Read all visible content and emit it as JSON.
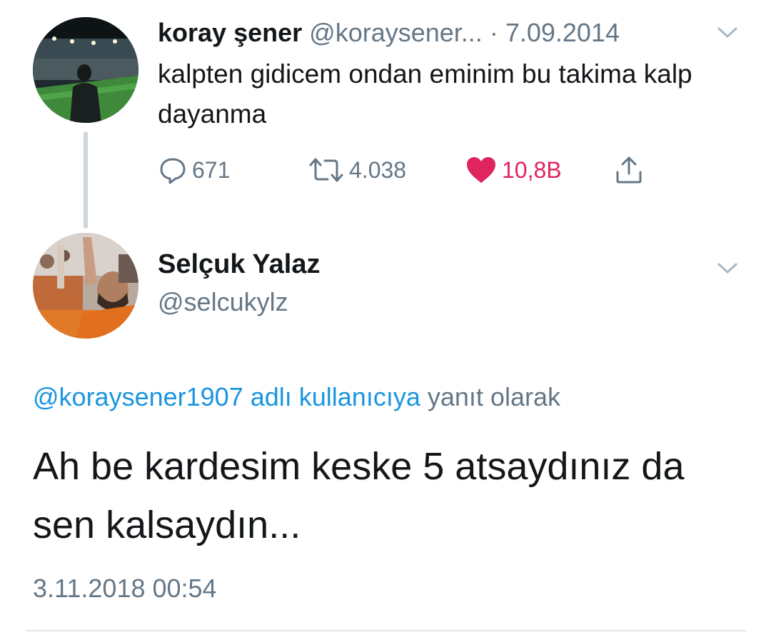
{
  "parent_tweet": {
    "display_name": "koray şener",
    "handle": "@koraysener...",
    "separator": "·",
    "date": "7.09.2014",
    "text": "kalpten gidicem ondan eminim bu takima kalp dayanma",
    "actions": {
      "reply_count": "671",
      "retweet_count": "4.038",
      "like_count": "10,8B"
    },
    "avatar_icon": "stadium-photo-avatar",
    "colors": {
      "like": "#e0245e",
      "secondary": "#657786"
    }
  },
  "reply_tweet": {
    "display_name": "Selçuk Yalaz",
    "handle": "@selcukylz",
    "context_mention": "@koraysener1907 adlı kullanıcıya",
    "context_suffix": "yanıt olarak",
    "text": "Ah be kardesim keske 5 atsaydınız da sen kalsaydın...",
    "timestamp": "3.11.2018 00:54",
    "avatar_icon": "fan-photo-avatar",
    "colors": {
      "mention": "#1b95e0"
    }
  }
}
